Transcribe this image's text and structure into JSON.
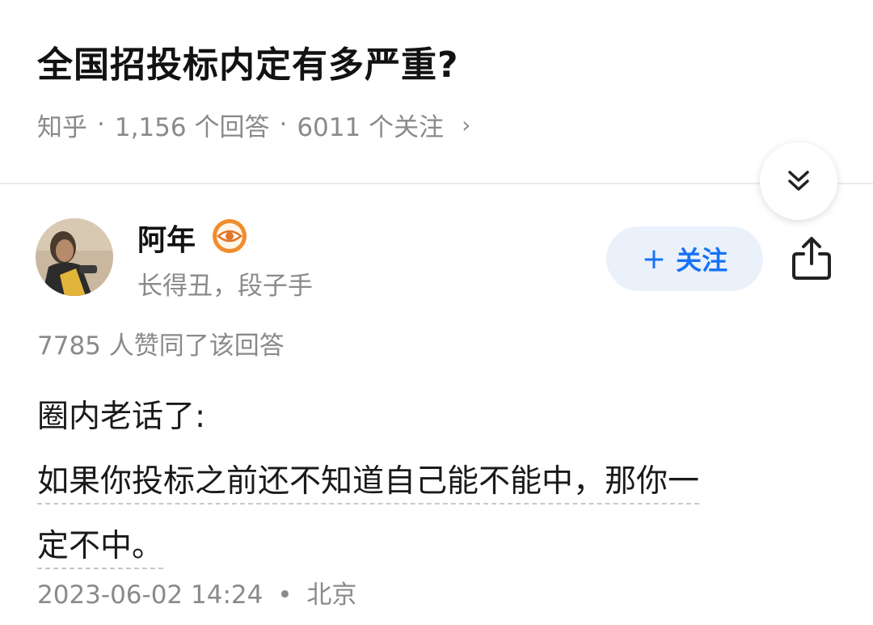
{
  "question": {
    "title": "全国招投标内定有多严重?",
    "source": "知乎",
    "separator": "·",
    "answer_count": "1,156 个回答",
    "follower_count": "6011 个关注",
    "chevron": "›"
  },
  "author": {
    "name": "阿年",
    "bio": "长得丑，段子手",
    "follow_label": "关注",
    "follow_plus": "+"
  },
  "answer": {
    "upvote_text": "7785 人赞同了该回答",
    "paragraph_1": "圈内老话了:",
    "paragraph_2_line_1": "如果你投标之前还不知道自己能不能中，那你一",
    "paragraph_2_line_2": "定不中。",
    "timestamp": "2023-06-02 14:24",
    "dot": "•",
    "location": "北京"
  },
  "colors": {
    "accent": "#1772f6",
    "follow_bg": "#ebf1fb",
    "secondary_text": "#8a8a8a",
    "badge_orange": "#f08c2b"
  },
  "icons": {
    "collapse": "double-chevron-down-icon",
    "share": "share-icon",
    "badge": "eye-badge-icon"
  }
}
